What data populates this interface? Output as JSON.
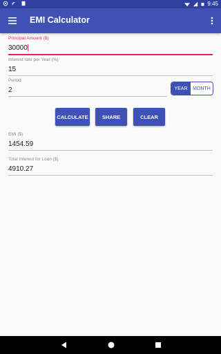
{
  "status_bar": {
    "time": "9:45"
  },
  "app_bar": {
    "title": "EMI Calculator",
    "menu_icon": "hamburger-menu-icon",
    "more_icon": "more-vert-icon"
  },
  "form": {
    "principal": {
      "label": "Principal Amount ($)",
      "value": "30000"
    },
    "interest": {
      "label": "Interest rate per Year (%)",
      "value": "15"
    },
    "period": {
      "label": "Period",
      "value": "2"
    },
    "period_unit": {
      "options": [
        "YEAR",
        "MONTH"
      ],
      "selected": "YEAR"
    }
  },
  "buttons": {
    "calculate": "CALCULATE",
    "share": "SHARE",
    "clear": "CLEAR"
  },
  "results": {
    "emi": {
      "label": "EMI ($)",
      "value": "1454.59"
    },
    "total_interest": {
      "label": "Total Interest for Loan ($)",
      "value": "4910.27"
    }
  },
  "colors": {
    "primary": "#3f51b5",
    "primary_dark": "#303f9f",
    "accent": "#e91e63"
  }
}
